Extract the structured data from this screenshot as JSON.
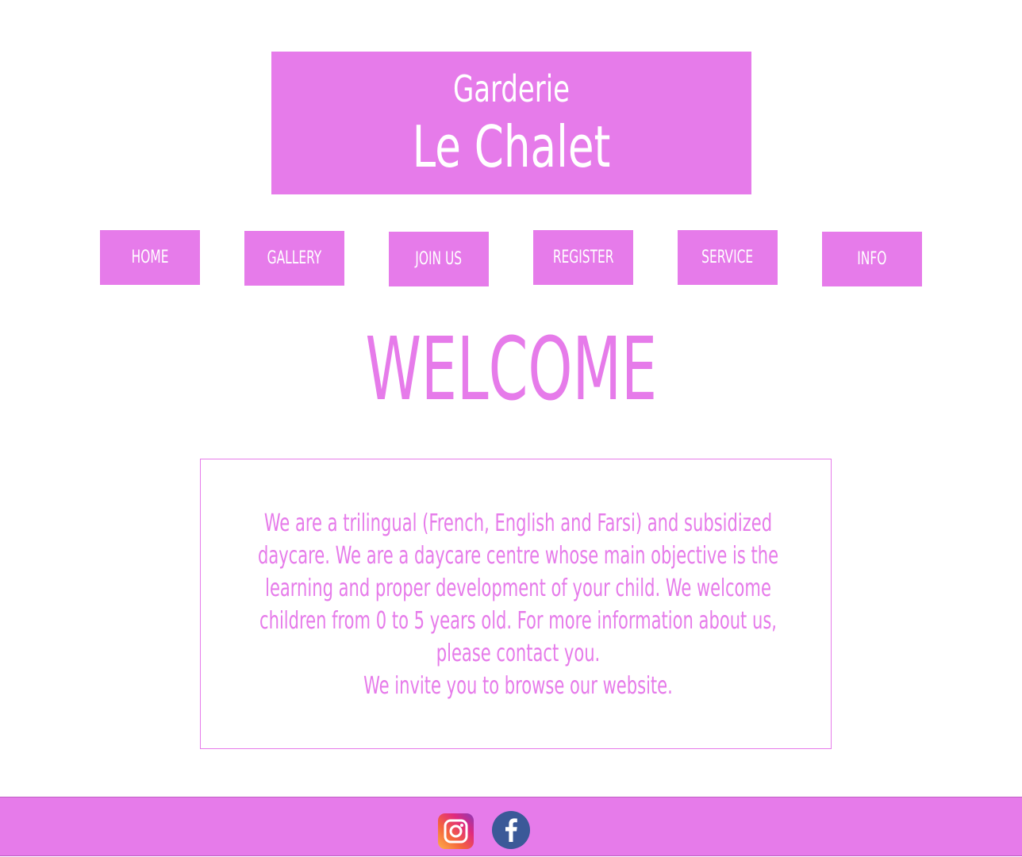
{
  "header": {
    "subtitle": "Garderie",
    "title": "Le Chalet"
  },
  "nav": [
    {
      "label": "HOME"
    },
    {
      "label": "GALLERY"
    },
    {
      "label": "JOIN US"
    },
    {
      "label": "REGISTER"
    },
    {
      "label": "SERVICE"
    },
    {
      "label": "INFO"
    }
  ],
  "main": {
    "heading": "WELCOME",
    "intro": "We are a trilingual (French, English and Farsi) and subsidized daycare. We are a daycare centre whose main objective is the learning and proper development of your child. We welcome children from 0 to 5 years old.  For more information about us, please contact you.",
    "invite": "We invite you to browse our website."
  },
  "footer": {
    "social": [
      {
        "icon": "instagram-icon"
      },
      {
        "icon": "facebook-icon"
      }
    ]
  },
  "colors": {
    "accent": "#e67bea",
    "text_on_accent": "#ffffff",
    "background": "#ffffff",
    "facebook_blue": "#3b5998"
  }
}
